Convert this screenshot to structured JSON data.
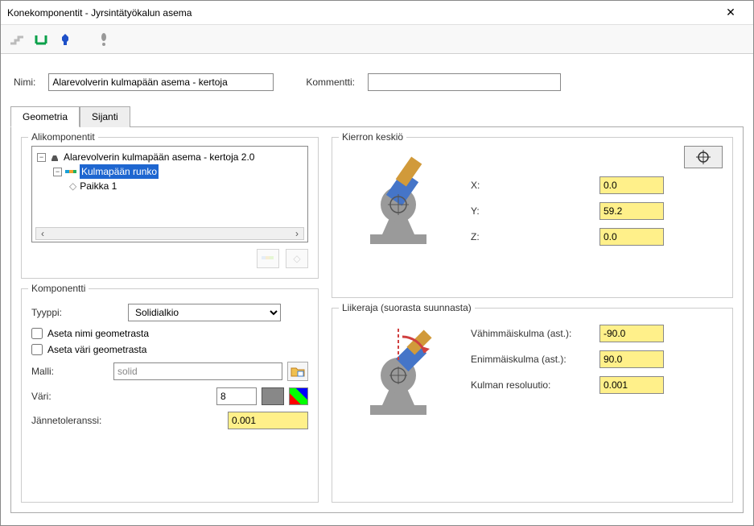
{
  "window": {
    "title": "Konekomponentit - Jyrsintätyökalun asema"
  },
  "form": {
    "name_label": "Nimi:",
    "name_value": "Alarevolverin kulmapään asema - kertoja",
    "comment_label": "Kommentti:",
    "comment_value": ""
  },
  "tabs": {
    "geometria": "Geometria",
    "sijanti": "Sijanti"
  },
  "subcomponents": {
    "legend": "Alikomponentit",
    "root": "Alarevolverin kulmapään asema - kertoja 2.0",
    "child1": "Kulmapään runko",
    "child2": "Paikka 1"
  },
  "component": {
    "legend": "Komponentti",
    "type_label": "Tyyppi:",
    "type_value": "Solidialkio",
    "set_name_geom": "Aseta nimi geometrasta",
    "set_color_geom": "Aseta väri geometrasta",
    "model_label": "Malli:",
    "model_value": "solid",
    "color_label": "Väri:",
    "color_index": "8",
    "tess_label": "Jännetoleranssi:",
    "tess_value": "0.001"
  },
  "rotation_center": {
    "legend": "Kierron keskiö",
    "x_label": "X:",
    "x_value": "0.0",
    "y_label": "Y:",
    "y_value": "59.2",
    "z_label": "Z:",
    "z_value": "0.0"
  },
  "range": {
    "legend": "Liikeraja (suorasta suunnasta)",
    "min_label": "Vähimmäiskulma (ast.):",
    "min_value": "-90.0",
    "max_label": "Enimmäiskulma (ast.):",
    "max_value": "90.0",
    "res_label": "Kulman resoluutio:",
    "res_value": "0.001"
  }
}
